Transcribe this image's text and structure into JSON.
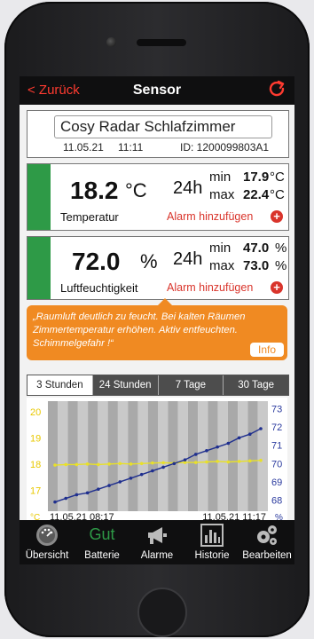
{
  "nav": {
    "back_label": "< Zurück",
    "title": "Sensor",
    "refresh_icon": "refresh-icon"
  },
  "sensor": {
    "name": "Cosy Radar Schlafzimmer",
    "date": "11.05.21",
    "time": "11:11",
    "id": "ID: 1200099803A1"
  },
  "temperature": {
    "value": "18.2",
    "unit": "°C",
    "period": "24h",
    "min_label": "min",
    "max_label": "max",
    "min": "17.9",
    "max": "22.4",
    "min_unit": "°C",
    "max_unit": "°C",
    "label": "Temperatur",
    "alarm_label": "Alarm hinzufügen"
  },
  "humidity": {
    "value": "72.0",
    "unit": "%",
    "period": "24h",
    "min_label": "min",
    "max_label": "max",
    "min": "47.0",
    "max": "73.0",
    "min_unit": "%",
    "max_unit": "%",
    "label": "Luftfeuchtigkeit",
    "alarm_label": "Alarm hinzufügen"
  },
  "warning": {
    "text": "„Raumluft deutlich zu feucht. Bei kalten Räumen Zimmertemperatur erhöhen. Aktiv entfeuchten. Schimmelgefahr !“",
    "info_label": "Info"
  },
  "time_tabs": [
    {
      "label": "3 Stunden",
      "active": true
    },
    {
      "label": "24 Stunden",
      "active": false
    },
    {
      "label": "7 Tage",
      "active": false
    },
    {
      "label": "30 Tage",
      "active": false
    }
  ],
  "chart_data": {
    "type": "line",
    "x_start_label": "11.05.21  08:17",
    "x_end_label": "11.05.21  11:17",
    "left_axis": {
      "unit": "°C",
      "ticks": [
        "20",
        "19",
        "18",
        "17"
      ],
      "range": [
        16.2,
        20.4
      ],
      "color": "#e8c800"
    },
    "right_axis": {
      "unit": "%",
      "ticks": [
        "73",
        "72",
        "71",
        "70",
        "69",
        "68"
      ],
      "range": [
        67.4,
        73.4
      ],
      "color": "#2a3a9e"
    },
    "series": [
      {
        "axis": "left",
        "color": "#e8e02a",
        "values": [
          17.96,
          17.98,
          17.98,
          18.0,
          17.98,
          18.0,
          18.02,
          18.0,
          18.02,
          18.04,
          18.05,
          18.04,
          18.06,
          18.06,
          18.08,
          18.1,
          18.08,
          18.1,
          18.12,
          18.14
        ]
      },
      {
        "axis": "right",
        "color": "#1f2f8e",
        "values": [
          67.9,
          68.1,
          68.3,
          68.4,
          68.6,
          68.8,
          69.0,
          69.2,
          69.4,
          69.6,
          69.8,
          70.0,
          70.2,
          70.5,
          70.7,
          70.9,
          71.1,
          71.4,
          71.6,
          71.9
        ]
      }
    ],
    "stripes": 22
  },
  "tabbar": [
    {
      "label": "Übersicht",
      "icon": "gauge-icon"
    },
    {
      "label": "Batterie",
      "status": "Gut",
      "icon": "battery-status"
    },
    {
      "label": "Alarme",
      "icon": "megaphone-icon"
    },
    {
      "label": "Historie",
      "icon": "bar-chart-icon"
    },
    {
      "label": "Bearbeiten",
      "icon": "gears-icon"
    }
  ],
  "colors": {
    "accent": "#ff3b30",
    "green": "#2e9a47",
    "warning": "#f08a22"
  }
}
